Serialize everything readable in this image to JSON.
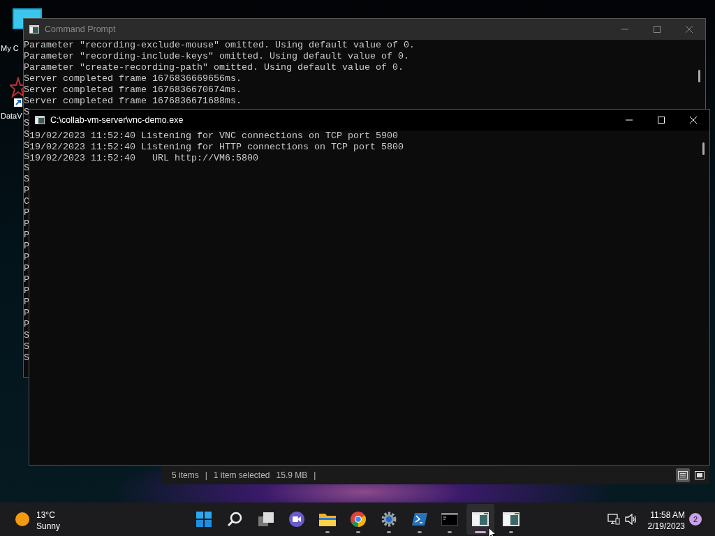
{
  "desktop_icons": [
    {
      "label": "My C",
      "kind": "computer"
    },
    {
      "label": "DataV",
      "kind": "shortcut"
    }
  ],
  "command_prompt": {
    "title": "Command Prompt",
    "lines": [
      "Parameter \"recording-exclude-mouse\" omitted. Using default value of 0.",
      "Parameter \"recording-include-keys\" omitted. Using default value of 0.",
      "Parameter \"create-recording-path\" omitted. Using default value of 0.",
      "Server completed frame 1676836669656ms.",
      "Server completed frame 1676836670674ms.",
      "Server completed frame 1676836671688ms."
    ],
    "clipped_lines": [
      "S",
      "S",
      "S",
      "S",
      "S",
      "S",
      "S",
      "P",
      "C",
      "P",
      "P",
      "P",
      "P",
      "P",
      "P",
      "P",
      "P",
      "P",
      "P",
      "P",
      "S",
      "S",
      "S"
    ]
  },
  "vnc_window": {
    "title": "C:\\collab-vm-server\\vnc-demo.exe",
    "lines": [
      "19/02/2023 11:52:40 Listening for VNC connections on TCP port 5900",
      "19/02/2023 11:52:40 Listening for HTTP connections on TCP port 5800",
      "19/02/2023 11:52:40   URL http://VM6:5800"
    ]
  },
  "explorer_status_bar": {
    "item_count": "5 items",
    "selection": "1 item selected",
    "size": "15.9 MB",
    "separators": [
      "|",
      "|"
    ],
    "views": [
      {
        "kind": "details",
        "selected": true
      },
      {
        "kind": "tiles",
        "selected": false
      }
    ]
  },
  "taskbar": {
    "weather": {
      "temperature": "13°C",
      "condition": "Sunny"
    },
    "apps": [
      {
        "kind": "start",
        "running": false,
        "active": false
      },
      {
        "kind": "search",
        "running": false,
        "active": false
      },
      {
        "kind": "taskview",
        "running": false,
        "active": false
      },
      {
        "kind": "chat",
        "running": false,
        "active": false
      },
      {
        "kind": "folder",
        "running": true,
        "active": false
      },
      {
        "kind": "browser",
        "running": true,
        "active": false
      },
      {
        "kind": "settings",
        "running": true,
        "active": false
      },
      {
        "kind": "powershell",
        "running": true,
        "active": false
      },
      {
        "kind": "terminal",
        "running": true,
        "active": false
      },
      {
        "kind": "window",
        "running": true,
        "active": true
      },
      {
        "kind": "window",
        "running": true,
        "active": false
      }
    ],
    "clock": {
      "time": "11:58 AM",
      "date": "2/19/2023"
    },
    "notifications": "2"
  }
}
